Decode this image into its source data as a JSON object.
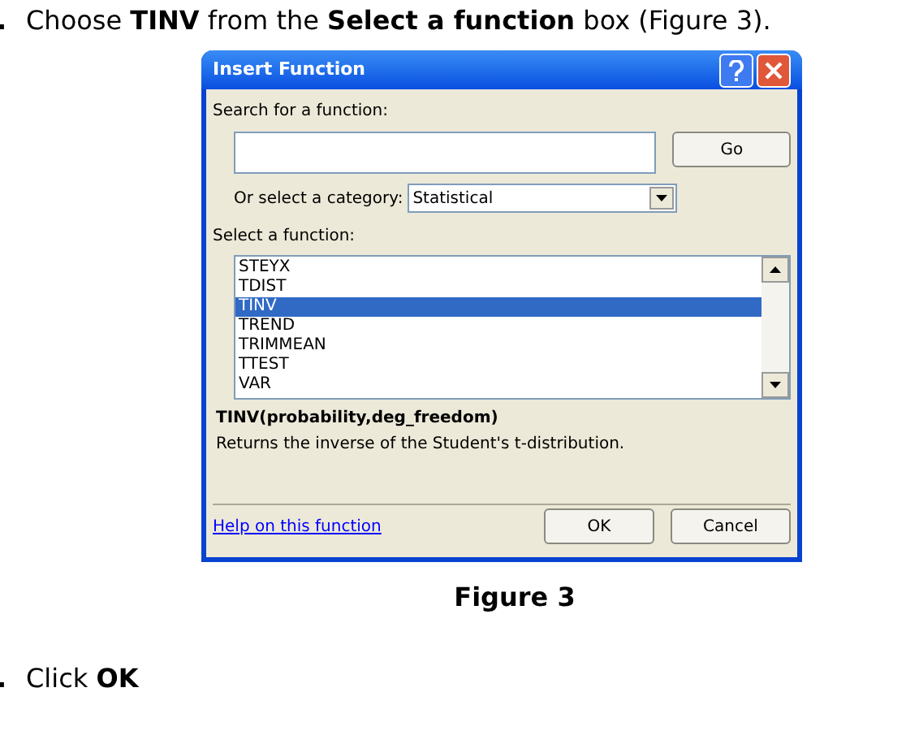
{
  "step_before": {
    "marker": ".",
    "text": "Choose **TINV** from the **Select a function** box (Figure 3)."
  },
  "dialog": {
    "title": "Insert Function",
    "search_label": "Search for a function:",
    "go_button": "Go",
    "category_label": "Or select a category:",
    "category_value": "Statistical",
    "function_label": "Select a function:",
    "functions": [
      {
        "name": "STEYX",
        "selected": false
      },
      {
        "name": "TDIST",
        "selected": false
      },
      {
        "name": "TINV",
        "selected": true
      },
      {
        "name": "TREND",
        "selected": false
      },
      {
        "name": "TRIMMEAN",
        "selected": false
      },
      {
        "name": "TTEST",
        "selected": false
      },
      {
        "name": "VAR",
        "selected": false
      }
    ],
    "syntax": "TINV(probability,deg_freedom)",
    "description": "Returns the inverse of the Student's t-distribution.",
    "help_link": "Help on this function",
    "ok_button": "OK",
    "cancel_button": "Cancel"
  },
  "caption": "Figure 3",
  "step_after": {
    "marker": ".",
    "text": "Click **OK**"
  }
}
